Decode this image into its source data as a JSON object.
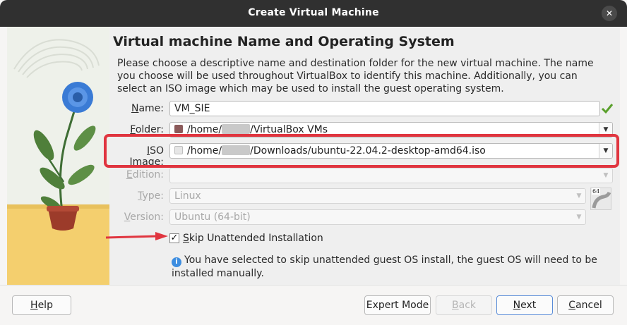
{
  "window": {
    "title": "Create Virtual Machine",
    "close_icon": "close-icon"
  },
  "page": {
    "heading": "Virtual machine Name and Operating System",
    "description": "Please choose a descriptive name and destination folder for the new virtual machine. The name you choose will be used throughout VirtualBox to identify this machine. Additionally, you can select an ISO image which may be used to install the guest operating system."
  },
  "form": {
    "name": {
      "label_u": "N",
      "label_rest": "ame:",
      "value": "VM_SIE"
    },
    "folder": {
      "label_u": "F",
      "label_rest": "older:",
      "prefix": "/home/",
      "suffix": "/VirtualBox VMs"
    },
    "iso": {
      "label_u": "I",
      "label_rest": "SO Image:",
      "prefix": "/home/",
      "suffix": "/Downloads/ubuntu-22.04.2-desktop-amd64.iso"
    },
    "edition": {
      "label_u": "E",
      "label_rest": "dition:",
      "value": ""
    },
    "type": {
      "label_u": "T",
      "label_rest": "ype:",
      "value": "Linux"
    },
    "version": {
      "label_u": "V",
      "label_rest": "ersion:",
      "value": "Ubuntu (64-bit)"
    },
    "os_badge": "64"
  },
  "skip": {
    "checked": true,
    "mark": "✓",
    "label_u": "S",
    "label_rest": "kip Unattended Installation",
    "info_icon": "i",
    "info_text": "You have selected to skip unattended guest OS install, the guest OS will need to be installed manually."
  },
  "buttons": {
    "help": {
      "u": "H",
      "rest": "elp"
    },
    "expert": {
      "u": "",
      "rest": "Expert Mode"
    },
    "back": {
      "u": "B",
      "rest": "ack"
    },
    "next": {
      "u": "N",
      "rest": "ext"
    },
    "cancel": {
      "u": "C",
      "rest": "ancel"
    }
  },
  "colors": {
    "highlight": "#e0353f",
    "arrow": "#e0353f",
    "valid_check": "#5aa02c",
    "flower": "#3a7bd5"
  }
}
